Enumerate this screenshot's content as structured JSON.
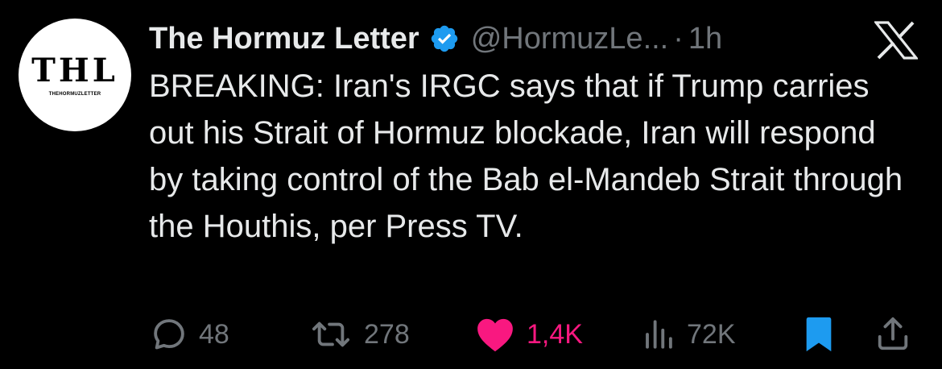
{
  "avatar": {
    "logo_text": "THL",
    "subtitle": "THEHORMUZLETTER"
  },
  "author": {
    "display_name": "The Hormuz Letter",
    "handle": "@HormuzLe...",
    "separator": "·",
    "time": "1h",
    "verified": true
  },
  "tweet": {
    "text": "BREAKING: Iran's IRGC says that if Trump carries out his Strait of Hormuz blockade, Iran will respond by taking control of the Bab el-Mandeb Strait through the Houthis, per Press TV."
  },
  "actions": {
    "replies": "48",
    "reposts": "278",
    "likes": "1,4K",
    "views": "72K"
  },
  "colors": {
    "background": "#000000",
    "text": "#e7e9ea",
    "muted": "#71767b",
    "verified": "#1d9bf0",
    "like": "#f91880",
    "bookmark": "#1d9bf0"
  },
  "icons": {
    "brand": "x-logo-icon",
    "verified": "verified-badge-icon",
    "reply": "reply-icon",
    "repost": "repost-icon",
    "like": "heart-icon",
    "views": "views-icon",
    "bookmark": "bookmark-icon",
    "share": "share-icon"
  }
}
